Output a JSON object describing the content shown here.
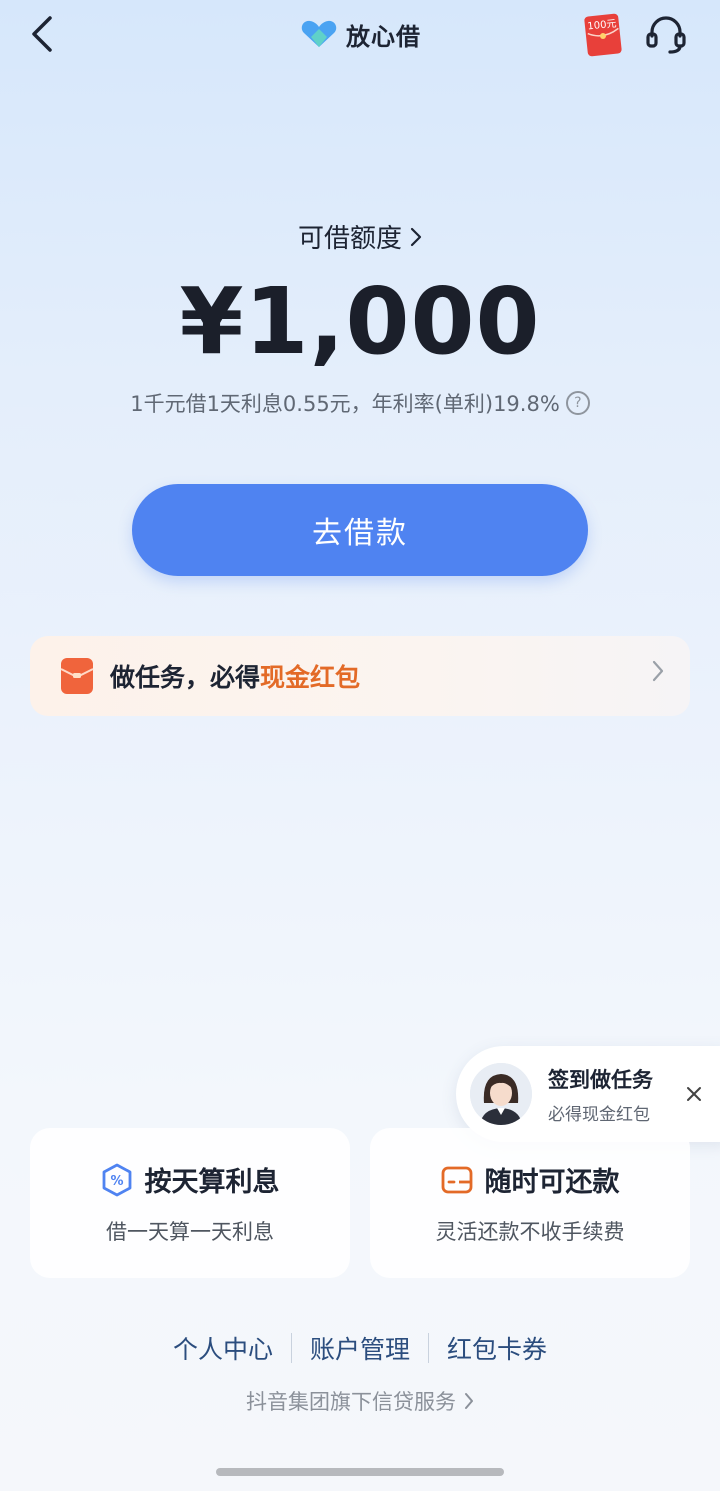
{
  "header": {
    "brand_name": "放心借",
    "coupon_badge_text": "100元"
  },
  "quota": {
    "label": "可借额度",
    "amount": "¥1,000",
    "rate_text": "1千元借1天利息0.55元，年利率(单利)19.8%"
  },
  "borrow_button": {
    "label": "去借款"
  },
  "task_banner": {
    "text_prefix": "做任务，必得",
    "text_highlight": "现金红包"
  },
  "float_card": {
    "title": "签到做任务",
    "subtitle": "必得现金红包"
  },
  "features": [
    {
      "title": "按天算利息",
      "desc": "借一天算一天利息",
      "icon": "percent-icon"
    },
    {
      "title": "随时可还款",
      "desc": "灵活还款不收手续费",
      "icon": "wallet-icon"
    }
  ],
  "footer": {
    "links": [
      "个人中心",
      "账户管理",
      "红包卡券"
    ],
    "note": "抖音集团旗下信贷服务"
  },
  "colors": {
    "primary": "#4f83f1",
    "highlight": "#e36a27",
    "footer_link": "#2b4d7e"
  }
}
